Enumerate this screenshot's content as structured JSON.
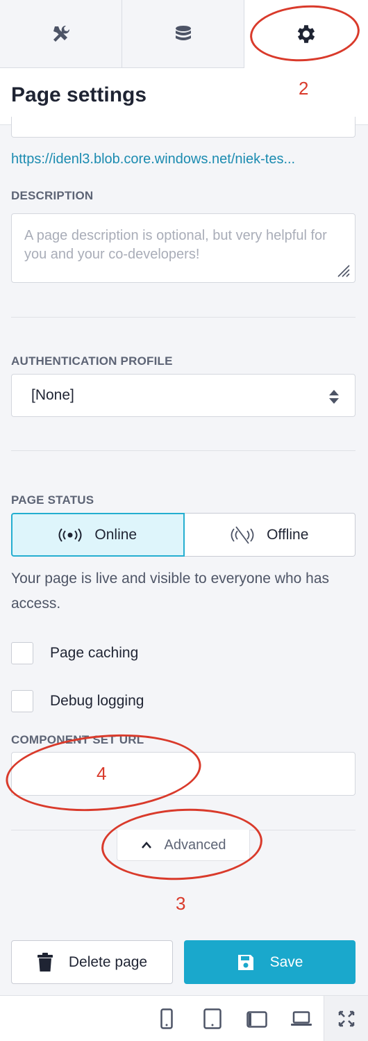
{
  "tabs": [
    {
      "icon": "tools-icon"
    },
    {
      "icon": "database-icon"
    },
    {
      "icon": "gear-icon",
      "active": true
    }
  ],
  "header": {
    "title": "Page settings"
  },
  "url": {
    "text": "https://idenl3.blob.core.windows.net/niek-tes..."
  },
  "description": {
    "label": "DESCRIPTION",
    "placeholder": "A page description is optional, but very helpful for you and your co-developers!"
  },
  "auth": {
    "label": "AUTHENTICATION PROFILE",
    "selected": "[None]"
  },
  "page_status": {
    "label": "PAGE STATUS",
    "online": "Online",
    "offline": "Offline",
    "help": "Your page is live and visible to everyone who has access."
  },
  "options": {
    "caching": "Page caching",
    "debug": "Debug logging"
  },
  "component_set": {
    "label": "COMPONENT SET URL"
  },
  "advanced": {
    "label": "Advanced"
  },
  "annotations": [
    "2",
    "3",
    "4"
  ],
  "footer": {
    "delete": "Delete page",
    "save": "Save"
  },
  "colors": {
    "accent": "#1aa8cc",
    "annotation": "#d93a2b",
    "online_bg": "#def5fb"
  }
}
